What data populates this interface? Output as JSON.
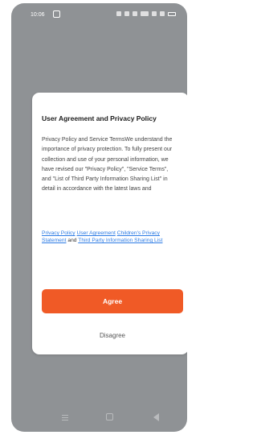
{
  "status_bar": {
    "time": "10:06"
  },
  "dialog": {
    "title": "User Agreement and Privacy Policy",
    "body": "Privacy Policy and Service TermsWe understand the importance of privacy protection. To fully present our collection and use of your personal information, we have revised our \"Privacy Policy\", \"Service Terms\", and \"List of Third Party Information Sharing List\" in detail in accordance with the latest laws and",
    "links": {
      "privacy_policy": "Privacy Policy",
      "user_agreement": "User Agreement",
      "childrens_privacy": "Children's Privacy Statement",
      "and_text": "and",
      "third_party_list": "Third Party Information Sharing List"
    },
    "agree_label": "Agree",
    "disagree_label": "Disagree"
  },
  "colors": {
    "accent": "#f05a26",
    "link": "#2c7be5",
    "overlay": "#8f9295"
  }
}
